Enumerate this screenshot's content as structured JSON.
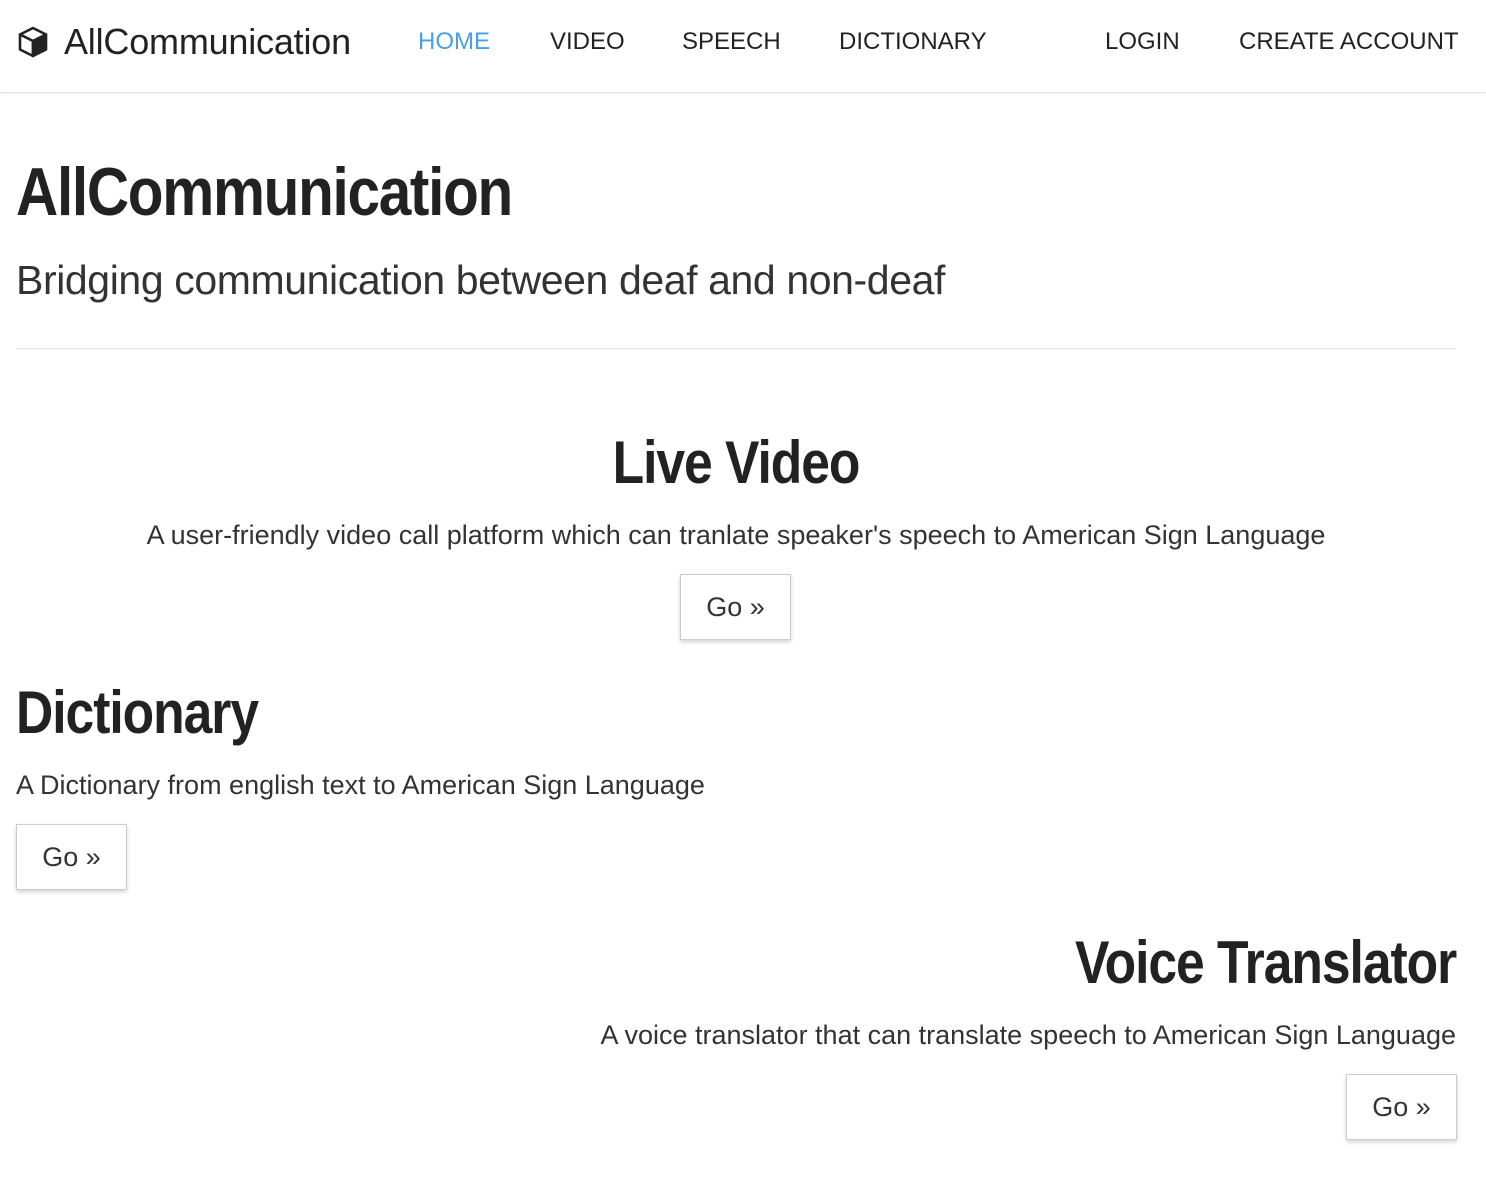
{
  "brand": {
    "name": "AllCommunication",
    "icon": "cube-icon"
  },
  "nav": {
    "links": [
      {
        "label": "HOME",
        "active": true
      },
      {
        "label": "VIDEO",
        "active": false
      },
      {
        "label": "SPEECH",
        "active": false
      },
      {
        "label": "DICTIONARY",
        "active": false
      }
    ],
    "login": "LOGIN",
    "create_account": "CREATE ACCOUNT",
    "active_color": "#4a9fe3"
  },
  "header": {
    "title": "AllCommunication",
    "subtitle": "Bridging communication between deaf and non-deaf"
  },
  "sections": {
    "live_video": {
      "title": "Live Video",
      "description": "A user-friendly video call platform which can tranlate speaker's speech to American Sign Language",
      "button": "Go »"
    },
    "dictionary": {
      "title": "Dictionary",
      "description": "A Dictionary from english text to American Sign Language",
      "button": "Go »"
    },
    "voice_translator": {
      "title": "Voice Translator",
      "description": "A voice translator that can translate speech to American Sign Language",
      "button": "Go »"
    }
  }
}
